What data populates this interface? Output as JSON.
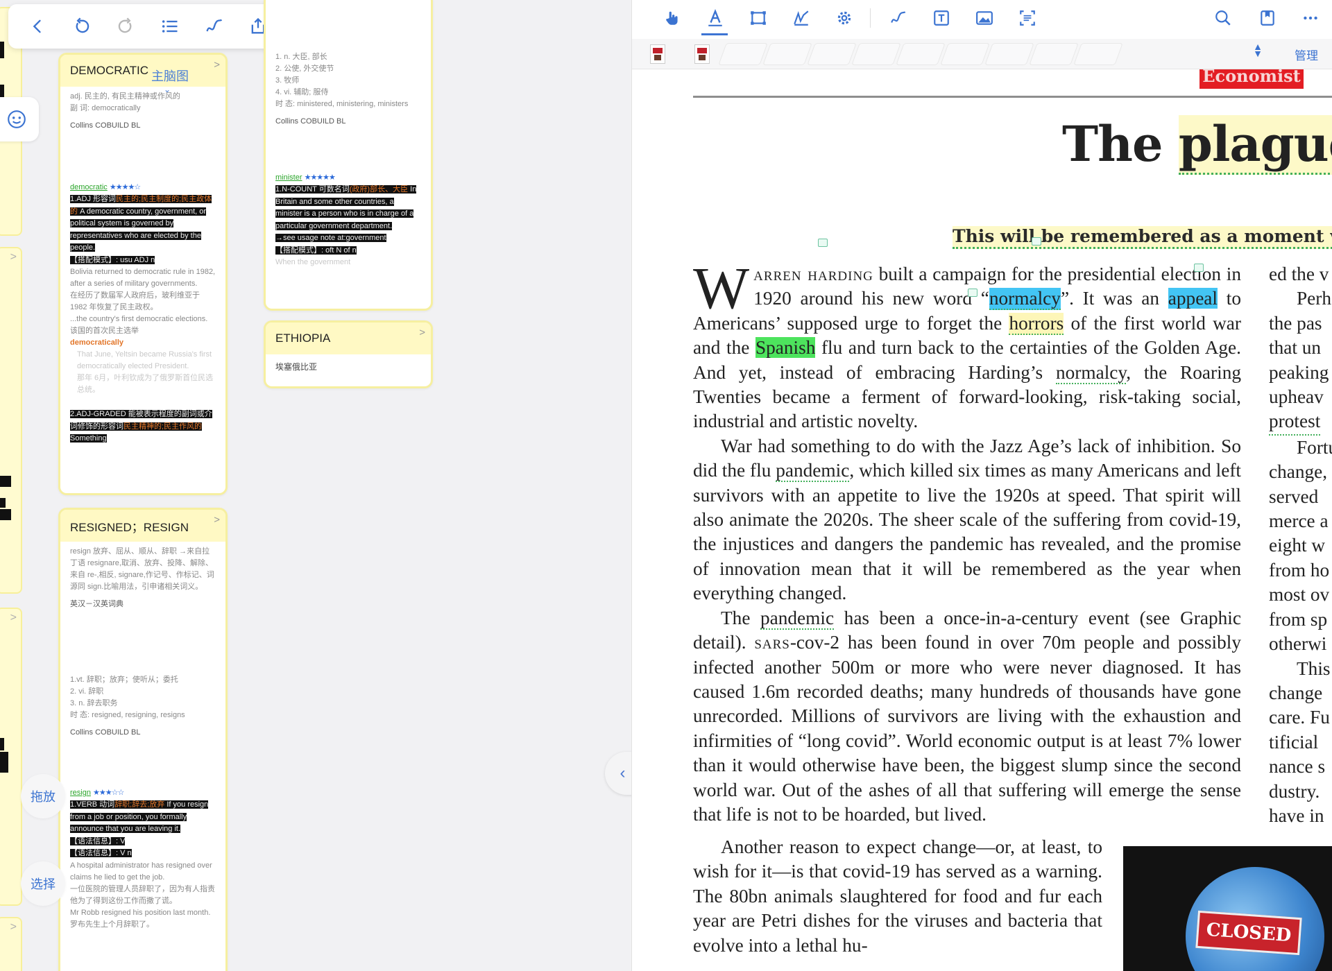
{
  "left": {
    "toolbar_icons": [
      "back-icon",
      "undo-icon",
      "redo-icon",
      "outline-list-icon",
      "pen-squiggle-icon",
      "share-icon",
      "more-icon"
    ],
    "main_map_label": "主脑图",
    "float_buttons": {
      "drag": "拖放",
      "select": "选择"
    },
    "cards": {
      "democratic": {
        "title": "DEMOCRATIC",
        "def1": "adj. 民主的, 有民主精神或作风的",
        "def2": "副 词: democratically",
        "source": "Collins COBUILD BL",
        "entry_word": "democratic",
        "stars": "★★★★☆",
        "sense1_a": "1.ADJ 形容词",
        "sense1_b": "民主的;民主制度的;民主政体的",
        "sense1_c": "A democratic country, government, or political system is governed by representatives who are elected by the people.",
        "pattern1": "【搭配模式】: usu ADJ n",
        "ex1": "Bolivia returned to democratic rule in 1982, after a series of military governments.",
        "ex1_cn": "在经历了数届军人政府后，玻利维亚于1982 年恢复了民主政权。",
        "ex2": "...the country's first democratic elections.",
        "ex2_cn": "该国的首次民主选举",
        "adverb": "democratically",
        "ex3": "That June, Yeltsin became Russia's first democratically elected President.",
        "ex3_cn": "那年 6月，叶利钦成为了俄罗斯首位民选总统。",
        "sense2_a": "2.ADJ-GRADED 能被表示程度的副词或介词修饰的形容词",
        "sense2_b": "民主精神的;民主作风的",
        "sense2_c": "Something"
      },
      "minister": {
        "lines": [
          "1.    n. 大臣, 部长",
          "2.    公使, 外交使节",
          "3.    牧师",
          "4.    vi. 辅助; 服侍"
        ],
        "tense": "时 态: ministered, ministering, ministers",
        "source": "Collins COBUILD BL",
        "entry_word": "minister",
        "stars": "★★★★★",
        "sense1_a": "1.N-COUNT 可数名词",
        "sense1_b": "(政府)部长、大臣",
        "sense1_c": "In Britain and some other countries, a minister is a person who is in charge of a particular government department.",
        "note": "→see usage note at:government",
        "pattern": "【搭配模式】: oft N of n",
        "tail": "When the government"
      },
      "ethiopia": {
        "title": "ETHIOPIA",
        "cn": "埃塞俄比亚"
      },
      "resigned": {
        "title": "RESIGNED；RESIGN",
        "etym": "resign 放弃、屈从、顺从、辞职 →来自拉丁语 resignare,取消、放弃、投降、解除、来自 re-,相反, signare,作记号、作标记、词源同 sign.比喻用法，引申诸相关词义。",
        "dict": "英汉－汉英词典",
        "lines": [
          "1.vt. 辞职；放弃；使听从；委托",
          "2.      vi. 辞职",
          "3.      n. 辞去职务"
        ],
        "tense": "时 态: resigned, resigning, resigns",
        "source": "Collins COBUILD BL",
        "entry_word": "resign",
        "stars": "★★★☆☆",
        "sense1_a": "1.VERB 动词",
        "sense1_b": "辞职;辞去;放弃",
        "sense1_c": "If you resign from a job or position, you formally announce that you are leaving it.",
        "info1": "【语法信息】: V",
        "info2": "【语法信息】: V n",
        "ex1": "A hospital administrator has resigned over claims he lied to get the job.",
        "ex1_cn": "一位医院的管理人员辞职了，因为有人指责他为了得到这份工作而撒了谎。",
        "ex2": "Mr Robb resigned his position last month.",
        "ex2_cn": "罗布先生上个月辞职了。"
      }
    }
  },
  "right": {
    "toolbar_icons": [
      "hand-tool-icon",
      "text-highlight-icon",
      "rectangle-select-icon",
      "signature-icon",
      "settings-gear-icon",
      "freehand-pen-icon",
      "text-box-icon",
      "image-icon",
      "ocr-icon",
      "search-icon",
      "bookmark-icon",
      "more-icon"
    ],
    "manage_label": "管理",
    "logo_text": "Economist",
    "headline_a": "The ",
    "headline_b": "plague",
    "subhead": "This will be remembered as a moment w",
    "p1": {
      "dropcap": "W",
      "sc": "arren harding",
      "t1": " built a campaign for the presidential election in 1920 around his new word “",
      "hl1": "normalcy",
      "t2": "”. It was an ",
      "hl2": "appeal",
      "t3": " to Americans’ supposed urge to forget the ",
      "hl3": "horrors",
      "t4": " of the first world war and the ",
      "hl4": "Spanish",
      "t5": " flu and turn back to the certainties of the Golden Age. And yet, instead of embracing Harding’s ",
      "ul1": "normalcy",
      "t6": ", the Roaring Twenties became a ferment of forward-looking, risk-taking social, industrial and artistic novelty."
    },
    "p2": {
      "t1": "War had something to do with the Jazz Age’s lack of inhibition. So did the flu ",
      "ul1": "pandemic",
      "t2": ", which killed six times as many Americans and left survivors with an appetite to live the 1920s at speed. That spirit will also animate the 2020s. The sheer scale of the suffering from covid-19, the injustices and dangers the pandemic has revealed, and the promise of innovation mean that it will be remembered as the year when everything changed."
    },
    "p3": {
      "t1": "The ",
      "ul1": "pandemic",
      "t2": " has been a once-in-a-century event (see Graphic detail). ",
      "sc": "sars",
      "t3": "-cov-2 has been found in over 70m people and possibly infected another 500m or more who were never diagnosed. It has caused 1.6m recorded deaths; many hundreds of thousands have gone unrecorded. Millions of survivors are living with the exhaustion and infirmities of “long covid”. World economic output is at least 7% lower than it would otherwise have been, the biggest slump since the second world war. Out of the ashes of all that suffering will emerge the sense that life is not to be hoarded, but lived."
    },
    "p4": "Another reason to expect change—or, at least, to wish for it—is that covid-19 has served as a warning. The 80bn animals slaughtered for food and fur each year are Petri dishes for the viruses and bacteria that evolve into a lethal hu-",
    "right_col": [
      "ed the v",
      "Perh",
      "the pas",
      "that un",
      "peaking",
      "upheav",
      "protest",
      "Fortu",
      "change,",
      "served",
      "merce a",
      "eight w",
      "from ho",
      "most ov",
      "from sp",
      "otherwi",
      "This",
      "change",
      "care. Fu",
      "tificial",
      "nance s",
      "dustry.",
      "have in"
    ],
    "photo_sign": "CLOSED"
  }
}
